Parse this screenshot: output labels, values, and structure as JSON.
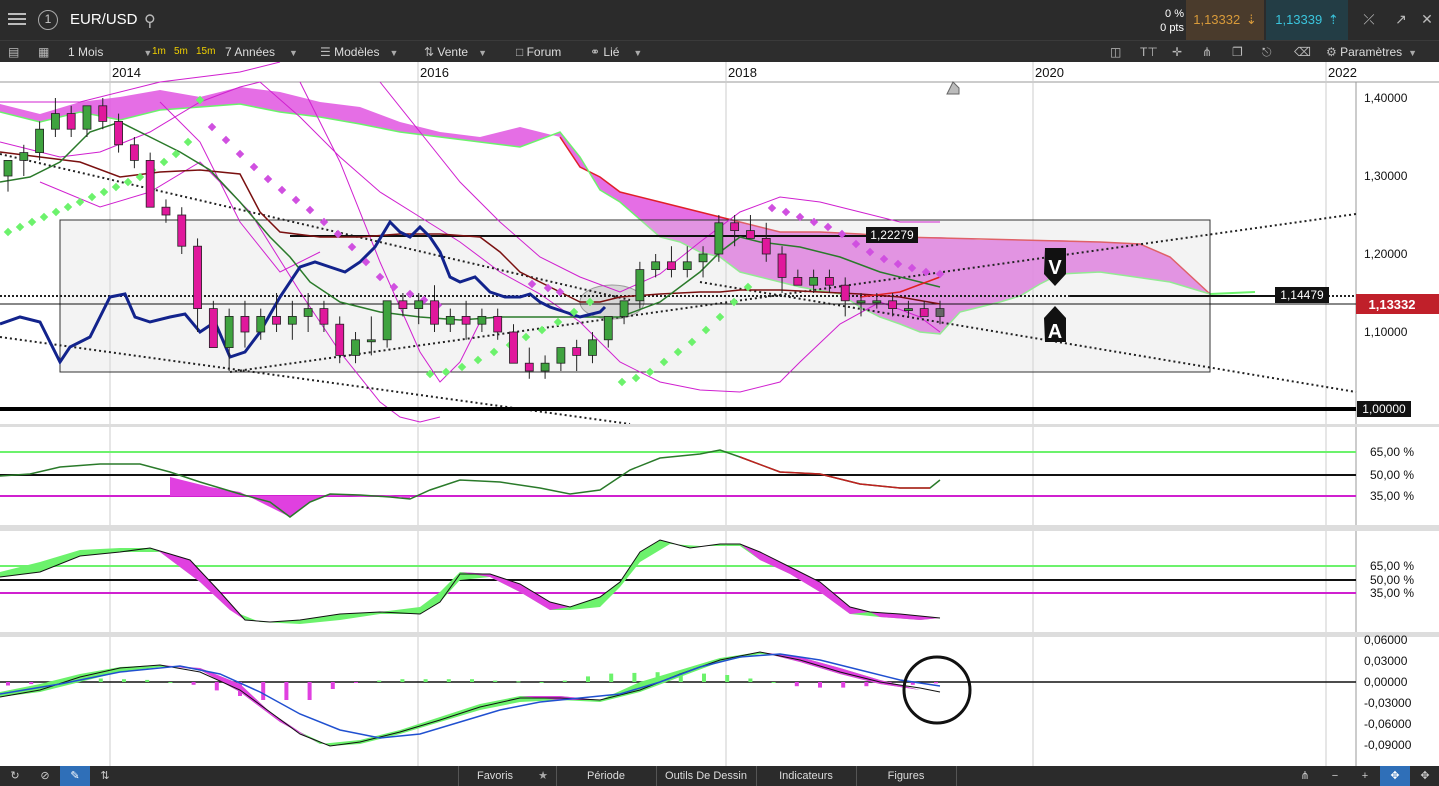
{
  "header": {
    "symbol": "EUR/USD",
    "change_pct": "0 %",
    "change_pts": "0 pts",
    "sell_price": "1,13332",
    "buy_price": "1,13339"
  },
  "toolbar": {
    "period": "1 Mois",
    "tf_1m": "1m",
    "tf_5m": "5m",
    "tf_15m": "15m",
    "range": "7 Années",
    "models": "Modèles",
    "sell": "Vente",
    "forum": "Forum",
    "linked": "Lié",
    "settings": "Paramètres"
  },
  "bottombar": {
    "favorites": "Favoris",
    "period": "Période",
    "drawing_tools": "Outils De Dessin",
    "indicators": "Indicateurs",
    "figures": "Figures"
  },
  "chart_data": [
    {
      "type": "candlestick",
      "panel": "price",
      "x_labels": [
        "2014",
        "2016",
        "2018",
        "2020",
        "2022"
      ],
      "y_ticks": [
        "1,40000",
        "1,30000",
        "1,20000",
        "1,10000",
        "1,00000"
      ],
      "ylim": [
        0.98,
        1.42
      ],
      "annotations": {
        "level_high": "1,22279",
        "level_mid": "1,14479",
        "last_price": "1,13332",
        "parity": "1,00000",
        "marker_v": "V",
        "marker_a": "A"
      },
      "colors": {
        "up": "#3fa33f",
        "down": "#e0189c",
        "cloud": "#e040e0",
        "price_tag": "#c0202a",
        "psar_up": "#6cf26c",
        "psar_down": "#d050e0"
      },
      "candles": [
        {
          "o": 1.3,
          "h": 1.31,
          "l": 1.28,
          "c": 1.32
        },
        {
          "o": 1.32,
          "h": 1.34,
          "l": 1.3,
          "c": 1.33
        },
        {
          "o": 1.33,
          "h": 1.37,
          "l": 1.32,
          "c": 1.36
        },
        {
          "o": 1.36,
          "h": 1.4,
          "l": 1.35,
          "c": 1.38
        },
        {
          "o": 1.38,
          "h": 1.39,
          "l": 1.35,
          "c": 1.36
        },
        {
          "o": 1.36,
          "h": 1.39,
          "l": 1.35,
          "c": 1.39
        },
        {
          "o": 1.39,
          "h": 1.4,
          "l": 1.36,
          "c": 1.37
        },
        {
          "o": 1.37,
          "h": 1.38,
          "l": 1.33,
          "c": 1.34
        },
        {
          "o": 1.34,
          "h": 1.35,
          "l": 1.31,
          "c": 1.32
        },
        {
          "o": 1.32,
          "h": 1.33,
          "l": 1.26,
          "c": 1.26
        },
        {
          "o": 1.26,
          "h": 1.27,
          "l": 1.24,
          "c": 1.25
        },
        {
          "o": 1.25,
          "h": 1.26,
          "l": 1.2,
          "c": 1.21
        },
        {
          "o": 1.21,
          "h": 1.22,
          "l": 1.1,
          "c": 1.13
        },
        {
          "o": 1.13,
          "h": 1.14,
          "l": 1.08,
          "c": 1.08
        },
        {
          "o": 1.08,
          "h": 1.13,
          "l": 1.05,
          "c": 1.12
        },
        {
          "o": 1.12,
          "h": 1.14,
          "l": 1.08,
          "c": 1.1
        },
        {
          "o": 1.1,
          "h": 1.13,
          "l": 1.09,
          "c": 1.12
        },
        {
          "o": 1.12,
          "h": 1.15,
          "l": 1.1,
          "c": 1.11
        },
        {
          "o": 1.11,
          "h": 1.14,
          "l": 1.09,
          "c": 1.12
        },
        {
          "o": 1.12,
          "h": 1.15,
          "l": 1.1,
          "c": 1.13
        },
        {
          "o": 1.13,
          "h": 1.14,
          "l": 1.1,
          "c": 1.11
        },
        {
          "o": 1.11,
          "h": 1.12,
          "l": 1.06,
          "c": 1.07
        },
        {
          "o": 1.07,
          "h": 1.1,
          "l": 1.06,
          "c": 1.09
        },
        {
          "o": 1.09,
          "h": 1.12,
          "l": 1.07,
          "c": 1.09
        },
        {
          "o": 1.09,
          "h": 1.14,
          "l": 1.08,
          "c": 1.14
        },
        {
          "o": 1.14,
          "h": 1.15,
          "l": 1.12,
          "c": 1.13
        },
        {
          "o": 1.13,
          "h": 1.15,
          "l": 1.11,
          "c": 1.14
        },
        {
          "o": 1.14,
          "h": 1.16,
          "l": 1.1,
          "c": 1.11
        },
        {
          "o": 1.11,
          "h": 1.13,
          "l": 1.1,
          "c": 1.12
        },
        {
          "o": 1.12,
          "h": 1.14,
          "l": 1.09,
          "c": 1.11
        },
        {
          "o": 1.11,
          "h": 1.13,
          "l": 1.1,
          "c": 1.12
        },
        {
          "o": 1.12,
          "h": 1.13,
          "l": 1.09,
          "c": 1.1
        },
        {
          "o": 1.1,
          "h": 1.11,
          "l": 1.06,
          "c": 1.06
        },
        {
          "o": 1.06,
          "h": 1.08,
          "l": 1.04,
          "c": 1.05
        },
        {
          "o": 1.05,
          "h": 1.07,
          "l": 1.04,
          "c": 1.06
        },
        {
          "o": 1.06,
          "h": 1.08,
          "l": 1.05,
          "c": 1.08
        },
        {
          "o": 1.08,
          "h": 1.09,
          "l": 1.05,
          "c": 1.07
        },
        {
          "o": 1.07,
          "h": 1.1,
          "l": 1.06,
          "c": 1.09
        },
        {
          "o": 1.09,
          "h": 1.12,
          "l": 1.08,
          "c": 1.12
        },
        {
          "o": 1.12,
          "h": 1.14,
          "l": 1.11,
          "c": 1.14
        },
        {
          "o": 1.14,
          "h": 1.19,
          "l": 1.13,
          "c": 1.18
        },
        {
          "o": 1.18,
          "h": 1.2,
          "l": 1.17,
          "c": 1.19
        },
        {
          "o": 1.19,
          "h": 1.21,
          "l": 1.17,
          "c": 1.18
        },
        {
          "o": 1.18,
          "h": 1.21,
          "l": 1.17,
          "c": 1.19
        },
        {
          "o": 1.19,
          "h": 1.21,
          "l": 1.17,
          "c": 1.2
        },
        {
          "o": 1.2,
          "h": 1.25,
          "l": 1.19,
          "c": 1.24
        },
        {
          "o": 1.24,
          "h": 1.25,
          "l": 1.21,
          "c": 1.23
        },
        {
          "o": 1.23,
          "h": 1.25,
          "l": 1.22,
          "c": 1.22
        },
        {
          "o": 1.22,
          "h": 1.24,
          "l": 1.19,
          "c": 1.2
        },
        {
          "o": 1.2,
          "h": 1.21,
          "l": 1.15,
          "c": 1.17
        },
        {
          "o": 1.17,
          "h": 1.18,
          "l": 1.16,
          "c": 1.16
        },
        {
          "o": 1.16,
          "h": 1.18,
          "l": 1.15,
          "c": 1.17
        },
        {
          "o": 1.17,
          "h": 1.18,
          "l": 1.15,
          "c": 1.16
        },
        {
          "o": 1.16,
          "h": 1.17,
          "l": 1.12,
          "c": 1.14
        },
        {
          "o": 1.14,
          "h": 1.15,
          "l": 1.12,
          "c": 1.14
        },
        {
          "o": 1.14,
          "h": 1.15,
          "l": 1.13,
          "c": 1.14
        },
        {
          "o": 1.14,
          "h": 1.15,
          "l": 1.12,
          "c": 1.13
        },
        {
          "o": 1.13,
          "h": 1.14,
          "l": 1.12,
          "c": 1.13
        },
        {
          "o": 1.13,
          "h": 1.14,
          "l": 1.12,
          "c": 1.12
        },
        {
          "o": 1.12,
          "h": 1.14,
          "l": 1.11,
          "c": 1.13
        }
      ]
    },
    {
      "type": "line",
      "panel": "rsi",
      "y_ticks": [
        "65,00 %",
        "50,00 %",
        "35,00 %"
      ],
      "levels": [
        65,
        50,
        35
      ],
      "ylim": [
        20,
        80
      ],
      "values": [
        48,
        49,
        52,
        55,
        57,
        58,
        58,
        57,
        55,
        52,
        47,
        44,
        40,
        36,
        30,
        32,
        38,
        40,
        39,
        40,
        38,
        36,
        40,
        42,
        45,
        48,
        47,
        46,
        44,
        41,
        42,
        40,
        38,
        40,
        44,
        48,
        52,
        56,
        60,
        62,
        64,
        66,
        64,
        62,
        58,
        56,
        52,
        50,
        48,
        47,
        46,
        45,
        44,
        45,
        48
      ]
    },
    {
      "type": "line",
      "panel": "stochastic",
      "y_ticks": [
        "65,00 %",
        "50,00 %",
        "35,00 %"
      ],
      "levels": [
        65,
        50,
        35
      ],
      "ylim": [
        0,
        100
      ],
      "values": [
        60,
        64,
        72,
        84,
        90,
        92,
        90,
        88,
        92,
        86,
        72,
        52,
        30,
        14,
        10,
        9,
        10,
        14,
        16,
        15,
        14,
        14,
        12,
        20,
        40,
        60,
        66,
        64,
        58,
        44,
        30,
        28,
        30,
        38,
        56,
        84,
        92,
        94,
        92,
        88,
        82,
        70,
        56,
        44,
        30,
        18,
        14,
        13,
        12,
        10,
        12
      ]
    },
    {
      "type": "line",
      "panel": "macd",
      "y_ticks": [
        "0,06000",
        "0,03000",
        "0,00000",
        "-0,03000",
        "-0,06000",
        "-0,09000"
      ],
      "ylim": [
        -0.1,
        0.065
      ],
      "macd": [
        -0.02,
        -0.015,
        -0.008,
        0.0,
        0.006,
        0.01,
        0.012,
        0.01,
        0.004,
        -0.01,
        -0.03,
        -0.055,
        -0.08,
        -0.095,
        -0.09,
        -0.085,
        -0.08,
        -0.072,
        -0.064,
        -0.056,
        -0.048,
        -0.045,
        -0.042,
        -0.042,
        -0.04,
        -0.03,
        -0.018,
        -0.005,
        0.01,
        0.02,
        0.032,
        0.042,
        0.045,
        0.04,
        0.03,
        0.018,
        0.006,
        -0.002,
        -0.006,
        -0.01,
        -0.012
      ],
      "signal": [
        -0.015,
        -0.012,
        -0.008,
        -0.004,
        0.001,
        0.006,
        0.009,
        0.01,
        0.008,
        0.002,
        -0.01,
        -0.028,
        -0.048,
        -0.068,
        -0.08,
        -0.084,
        -0.082,
        -0.076,
        -0.068,
        -0.06,
        -0.052,
        -0.047,
        -0.043,
        -0.042,
        -0.042,
        -0.038,
        -0.03,
        -0.018,
        -0.004,
        0.008,
        0.02,
        0.032,
        0.04,
        0.04,
        0.036,
        0.026,
        0.014,
        0.004,
        -0.002,
        -0.006,
        -0.01
      ]
    }
  ]
}
